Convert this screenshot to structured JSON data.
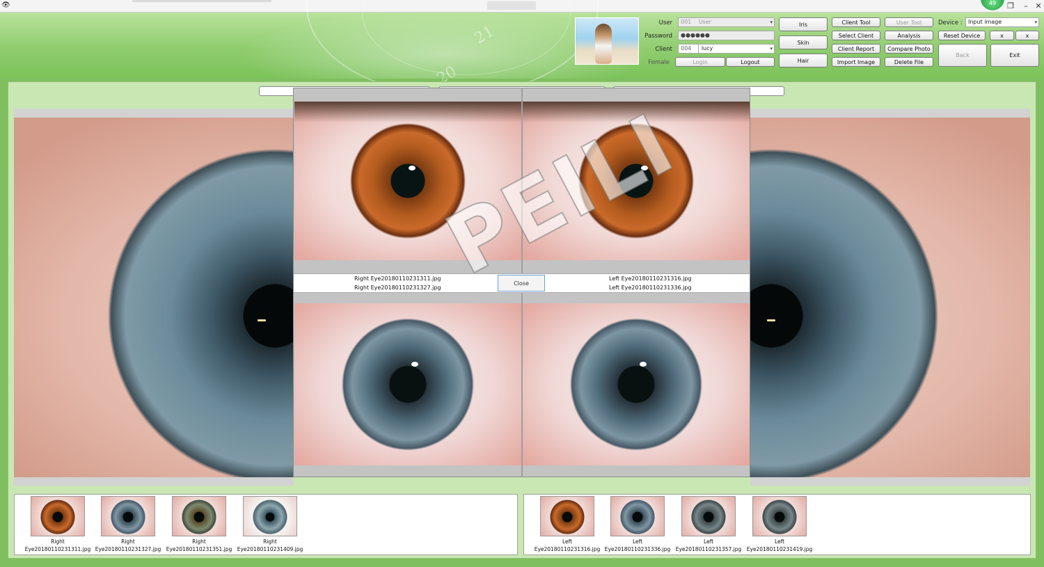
{
  "window": {
    "minimize_glyph": "–",
    "restore_glyph": "❐",
    "close_glyph": "✕",
    "badge": "49"
  },
  "login": {
    "user_label": "User",
    "user_id": "001",
    "user_value": "User",
    "password_label": "Password",
    "password_value": "●●●●●●",
    "client_label": "Client",
    "client_id": "004",
    "client_value": "lucy",
    "gender": "Female",
    "login_button": "Login",
    "logout_button": "Logout"
  },
  "modes": {
    "iris": "Iris",
    "skin": "Skin",
    "hair": "Hair"
  },
  "tools": {
    "client_tool": "Client Tool",
    "user_tool": "User Tool",
    "select_client": "Select Client",
    "analysis": "Analysis",
    "client_report": "Client Report",
    "compare_photo": "Compare Photo",
    "import_image": "Import Image",
    "delete_file": "Delete File"
  },
  "device": {
    "label": "Device :",
    "value": "Input image",
    "reset_button": "Reset Device",
    "x1": "x",
    "x2": "x",
    "back_button": "Back",
    "exit_button": "Exit"
  },
  "decor": {
    "dial_21": "21",
    "dial_20": "20"
  },
  "compare": {
    "right_file_1": "Right Eye20180110231311.jpg",
    "right_file_2": "Right Eye20180110231327.jpg",
    "left_file_1": "Left Eye20180110231316.jpg",
    "left_file_2": "Left Eye20180110231336.jpg",
    "close_button": "Close",
    "watermark": "PEILI"
  },
  "thumbnails": {
    "right": [
      {
        "side": "Right",
        "file": "Eye20180110231311.jpg",
        "color": "brown"
      },
      {
        "side": "Right",
        "file": "Eye20180110231327.jpg",
        "color": "blue"
      },
      {
        "side": "Right",
        "file": "Eye20180110231351.jpg",
        "color": "hazel"
      },
      {
        "side": "Right",
        "file": "Eye20180110231409.jpg",
        "color": "grey-blue"
      }
    ],
    "left": [
      {
        "side": "Left",
        "file": "Eye20180110231316.jpg",
        "color": "brown"
      },
      {
        "side": "Left",
        "file": "Eye20180110231336.jpg",
        "color": "blue"
      },
      {
        "side": "Left",
        "file": "Eye20180110231357.jpg",
        "color": "grey"
      },
      {
        "side": "Left",
        "file": "Eye20180110231419.jpg",
        "color": "grey"
      }
    ]
  },
  "colors": {
    "frame_green": "#8fcd6e",
    "workspace_green": "#c9e7b3",
    "close_focus_border": "#6aa0d8"
  }
}
